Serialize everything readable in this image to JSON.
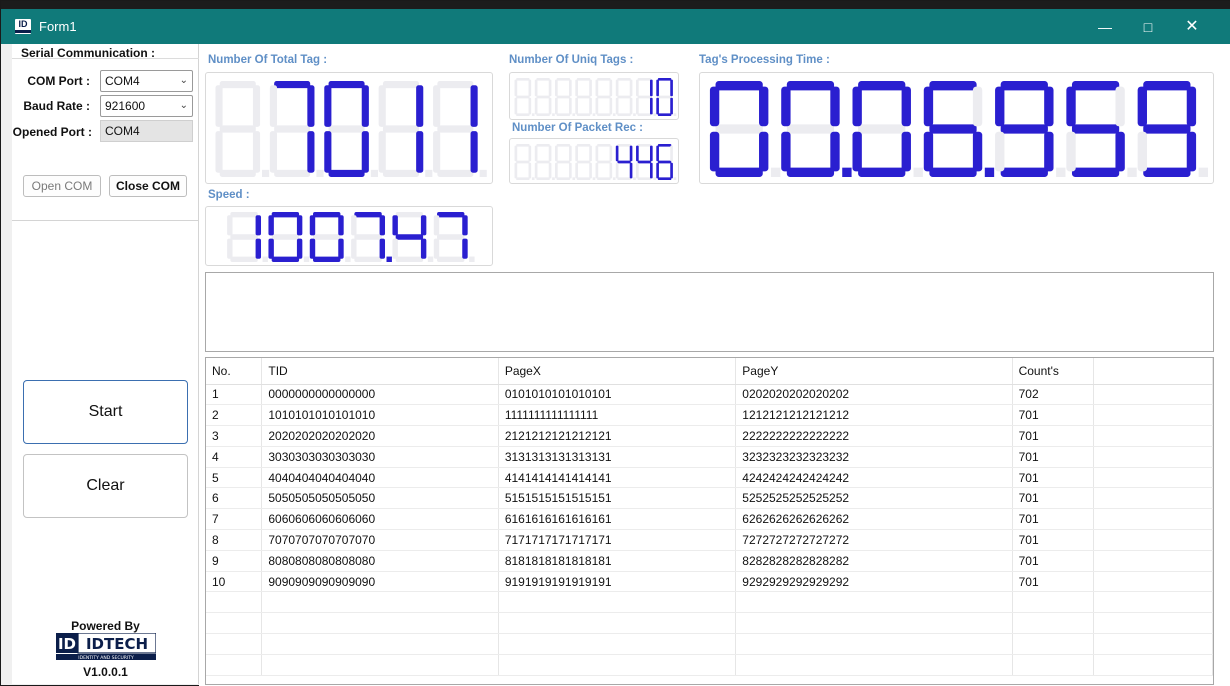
{
  "window": {
    "title": "Form1",
    "controls": [
      "minimize-icon",
      "maximize-icon",
      "close-icon"
    ]
  },
  "serial": {
    "group_title": "Serial Communication :",
    "com_port_label": "COM Port :",
    "com_port_value": "COM4",
    "baud_rate_label": "Baud Rate :",
    "baud_rate_value": "921600",
    "opened_port_label": "Opened Port :",
    "opened_port_value": "COM4",
    "open_com_label": "Open COM",
    "close_com_label": "Close COM"
  },
  "buttons": {
    "start_label": "Start",
    "clear_label": "Clear"
  },
  "footer": {
    "powered_by": "Powered By",
    "logo_text": "IDTECH",
    "logo_tagline": "IDENTITY AND SECURITY",
    "version": "V1.0.0.1"
  },
  "displays": {
    "total_tag": {
      "label": "Number Of Total Tag :",
      "value": "7011",
      "digits": 5
    },
    "uniq_tags": {
      "label": "Number Of Uniq Tags :",
      "value": "10",
      "digits": 8
    },
    "packet_rec": {
      "label": "Number Of Packet Rec :",
      "value": "446",
      "digits": 8
    },
    "processing_time": {
      "label": "Tag's Processing Time :",
      "value": "00.06.959",
      "digits": 7
    },
    "speed": {
      "label": "Speed :",
      "value": "1007.47",
      "digits": 6
    },
    "seg_color": "#2a1fd0",
    "ghost_color": "#ececf0"
  },
  "table": {
    "columns": [
      "No.",
      "TID",
      "PageX",
      "PageY",
      "Count's",
      ""
    ],
    "rows": [
      [
        "1",
        "0000000000000000",
        "0101010101010101",
        "0202020202020202",
        "702",
        ""
      ],
      [
        "2",
        "1010101010101010",
        "1111111111111111",
        "1212121212121212",
        "701",
        ""
      ],
      [
        "3",
        "2020202020202020",
        "2121212121212121",
        "2222222222222222",
        "701",
        ""
      ],
      [
        "4",
        "3030303030303030",
        "3131313131313131",
        "3232323232323232",
        "701",
        ""
      ],
      [
        "5",
        "4040404040404040",
        "4141414141414141",
        "4242424242424242",
        "701",
        ""
      ],
      [
        "6",
        "5050505050505050",
        "5151515151515151",
        "5252525252525252",
        "701",
        ""
      ],
      [
        "7",
        "6060606060606060",
        "6161616161616161",
        "6262626262626262",
        "701",
        ""
      ],
      [
        "8",
        "7070707070707070",
        "7171717171717171",
        "7272727272727272",
        "701",
        ""
      ],
      [
        "9",
        "8080808080808080",
        "8181818181818181",
        "8282828282828282",
        "701",
        ""
      ],
      [
        "10",
        "9090909090909090",
        "9191919191919191",
        "9292929292929292",
        "701",
        ""
      ]
    ],
    "empty_rows": 4
  }
}
